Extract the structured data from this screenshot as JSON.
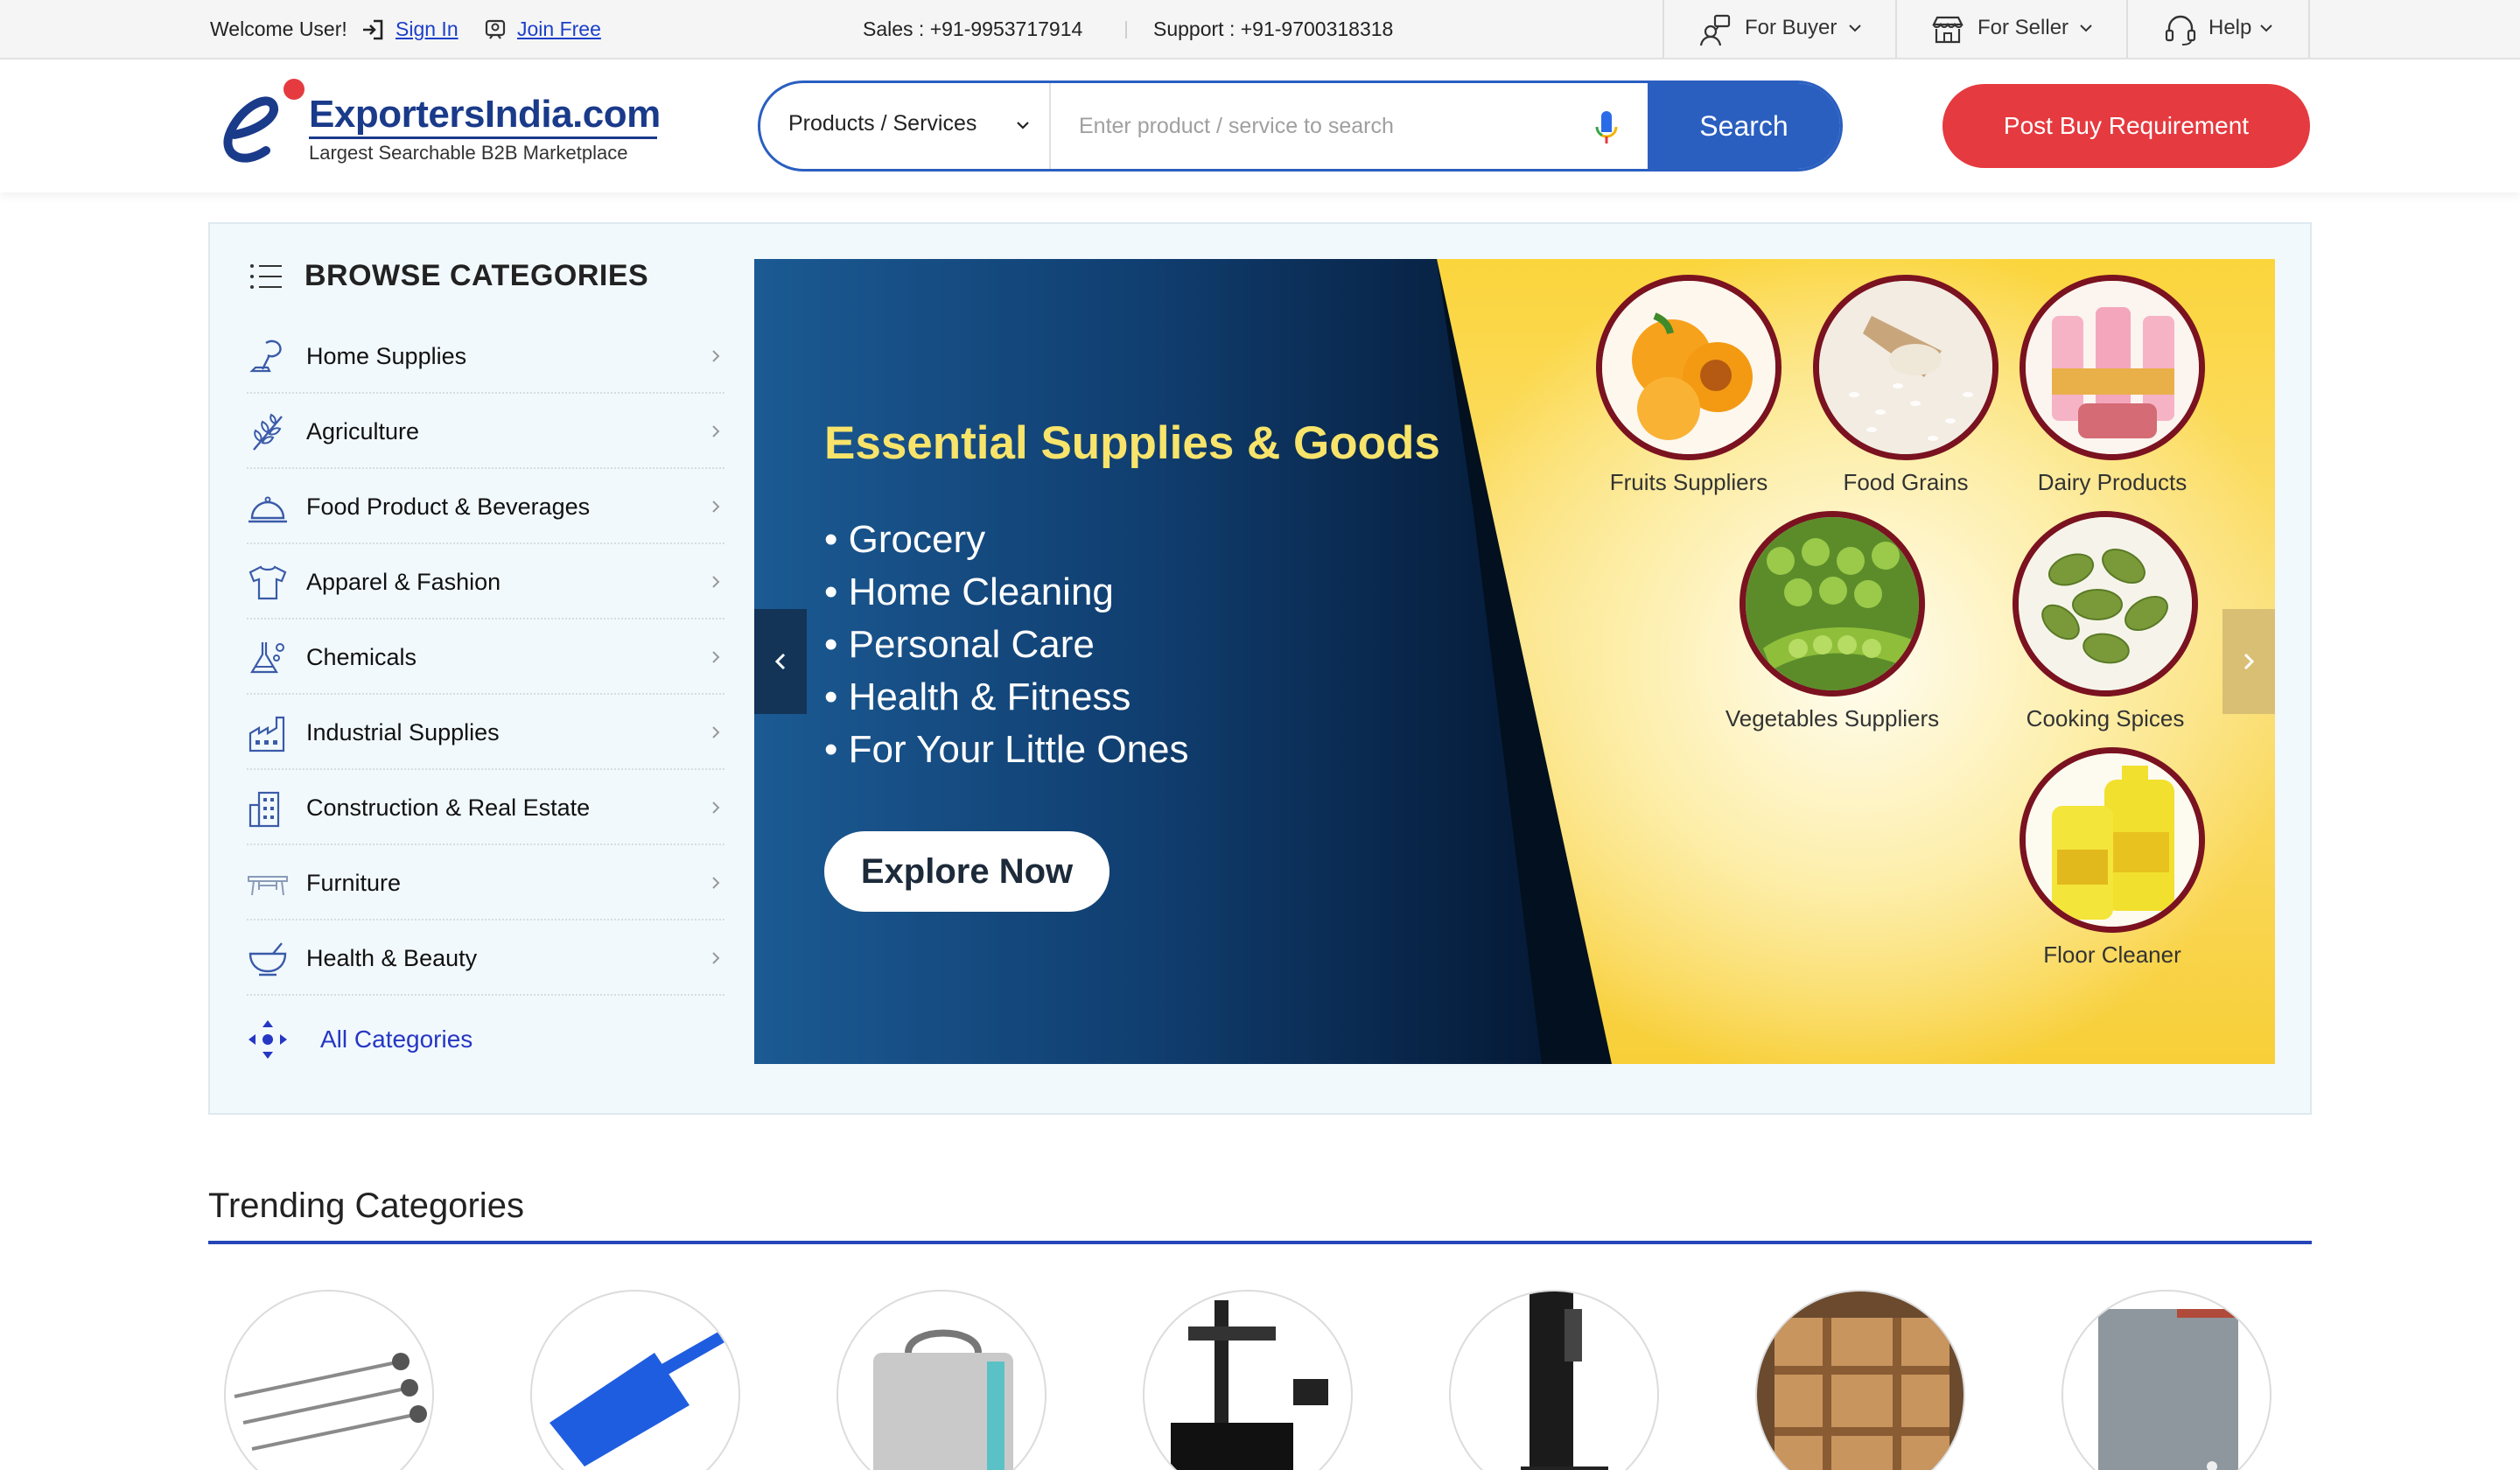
{
  "topbar": {
    "welcome": "Welcome User!",
    "sign_in": "Sign In",
    "join_free": "Join Free",
    "sales": "Sales : +91-9953717914",
    "support": "Support : +91-9700318318",
    "for_buyer": "For Buyer",
    "for_seller": "For Seller",
    "help": "Help"
  },
  "logo": {
    "name": "ExportersIndia.com",
    "tagline": "Largest Searchable B2B Marketplace"
  },
  "search": {
    "category": "Products / Services",
    "placeholder": "Enter product / service to search",
    "button": "Search"
  },
  "post_requirement": "Post Buy Requirement",
  "browse": {
    "title": "BROWSE CATEGORIES",
    "items": [
      {
        "label": "Home Supplies",
        "icon": "vacuum-icon"
      },
      {
        "label": "Agriculture",
        "icon": "wheat-icon"
      },
      {
        "label": "Food Product & Beverages",
        "icon": "food-cloche-icon"
      },
      {
        "label": "Apparel & Fashion",
        "icon": "tshirt-icon"
      },
      {
        "label": "Chemicals",
        "icon": "flask-icon"
      },
      {
        "label": "Industrial Supplies",
        "icon": "factory-icon"
      },
      {
        "label": "Construction & Real Estate",
        "icon": "building-icon"
      },
      {
        "label": "Furniture",
        "icon": "table-icon"
      },
      {
        "label": "Health & Beauty",
        "icon": "bowl-icon"
      }
    ],
    "all_categories": "All Categories"
  },
  "banner": {
    "title": "Essential Supplies & Goods",
    "bullets": [
      "• Grocery",
      "• Home Cleaning",
      "• Personal Care",
      "• Health & Fitness",
      "• For Your Little Ones"
    ],
    "cta": "Explore Now",
    "products": [
      "Fruits Suppliers",
      "Food Grains",
      "Dairy Products",
      "Vegetables Suppliers",
      "Cooking Spices",
      "Floor Cleaner"
    ]
  },
  "trending": {
    "title": "Trending Categories",
    "items": [
      "surgical-instruments-image",
      "dustpan-image",
      "felt-bag-image",
      "measuring-machine-image",
      "microscope-stand-image",
      "wooden-crate-image",
      "water-heater-image"
    ]
  },
  "colors": {
    "brand_blue": "#2a5fc0",
    "accent_red": "#e53a3f",
    "link_blue": "#2637c4",
    "banner_yellow": "#fbd53c",
    "banner_navy": "#0b2e57"
  }
}
